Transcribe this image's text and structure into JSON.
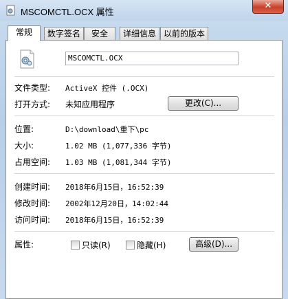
{
  "window": {
    "title": "MSCOMCTL.OCX 属性",
    "close_label": "✕"
  },
  "tabs": [
    {
      "label": "常规"
    },
    {
      "label": "数字签名"
    },
    {
      "label": "安全"
    },
    {
      "label": "详细信息"
    },
    {
      "label": "以前的版本"
    }
  ],
  "general": {
    "filename": "MSCOMCTL.OCX",
    "file_type_label": "文件类型:",
    "file_type_value": "ActiveX 控件 (.OCX)",
    "opens_with_label": "打开方式:",
    "opens_with_value": "未知应用程序",
    "change_button": "更改(C)...",
    "location_label": "位置:",
    "location_value": "D:\\download\\重下\\pc",
    "size_label": "大小:",
    "size_value": "1.02 MB (1,077,336 字节)",
    "size_on_disk_label": "占用空间:",
    "size_on_disk_value": "1.03 MB (1,081,344 字节)",
    "created_label": "创建时间:",
    "created_value": "2018年6月15日，16:52:39",
    "modified_label": "修改时间:",
    "modified_value": "2002年12月20日，14:02:44",
    "accessed_label": "访问时间:",
    "accessed_value": "2018年6月15日，16:52:39",
    "attributes_label": "属性:",
    "readonly_label": "只读(R)",
    "hidden_label": "隐藏(H)",
    "advanced_button": "高级(D)..."
  }
}
